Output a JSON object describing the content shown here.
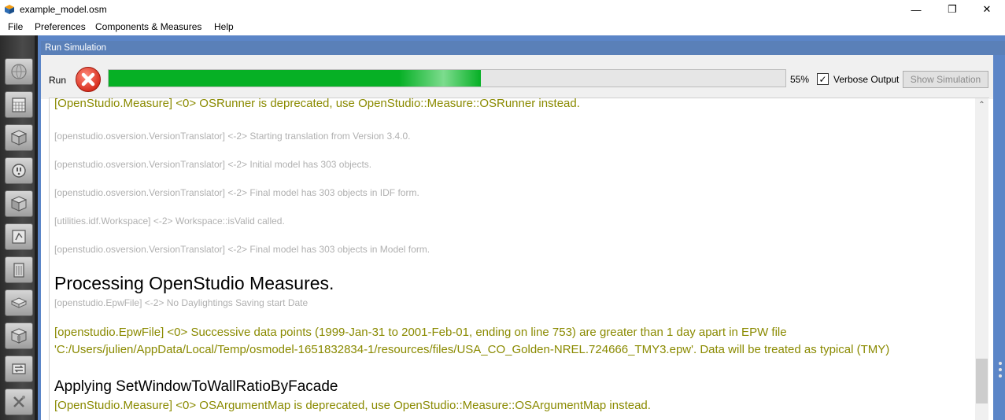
{
  "window": {
    "title": "example_model.osm"
  },
  "window_controls": {
    "minimize": "—",
    "maximize": "❐",
    "close": "✕"
  },
  "menu": {
    "items": [
      "File",
      "Preferences",
      "Components & Measures",
      "Help"
    ]
  },
  "sidebar": {
    "items": [
      "site-icon",
      "schedules-icon",
      "constructions-icon",
      "loads-icon",
      "space-types-icon",
      "geometry-icon",
      "facility-icon",
      "spaces-icon",
      "thermal-zones-icon",
      "hvac-systems-icon",
      "variables-icon"
    ]
  },
  "panel": {
    "title": "Run Simulation"
  },
  "toolbar": {
    "run_label": "Run",
    "progress_percent": 55,
    "progress_text": "55%",
    "verbose_label": "Verbose Output",
    "verbose_checked": true,
    "verbose_check_glyph": "✓",
    "show_simulation_label": "Show Simulation"
  },
  "output": {
    "lines": [
      "[OpenStudio.Measure] <0> OSRunner is deprecated, use OpenStudio::Measure::OSRunner instead.",
      "[openstudio.osversion.VersionTranslator] <-2> Starting translation from Version 3.4.0.",
      "[openstudio.osversion.VersionTranslator] <-2> Initial model has 303 objects.",
      "[openstudio.osversion.VersionTranslator] <-2> Final model has 303 objects in IDF form.",
      "[utilities.idf.Workspace] <-2> Workspace::isValid called.",
      "[openstudio.osversion.VersionTranslator] <-2> Final model has 303 objects in Model form.",
      "Processing OpenStudio Measures.",
      "[openstudio.EpwFile] <-2> No Daylightings Saving start Date",
      "[openstudio.EpwFile] <0> Successive data points (1999-Jan-31 to 2001-Feb-01, ending on line 753) are greater than 1 day apart in EPW file 'C:/Users/julien/AppData/Local/Temp/osmodel-1651832834-1/resources/files/USA_CO_Golden-NREL.724666_TMY3.epw'. Data will be treated as typical (TMY)",
      "Applying SetWindowToWallRatioByFacade",
      "[OpenStudio.Measure] <0> OSArgumentMap is deprecated, use OpenStudio::Measure::OSArgumentMap instead."
    ]
  },
  "scrollbar": {
    "up_arrow": "⌃"
  }
}
